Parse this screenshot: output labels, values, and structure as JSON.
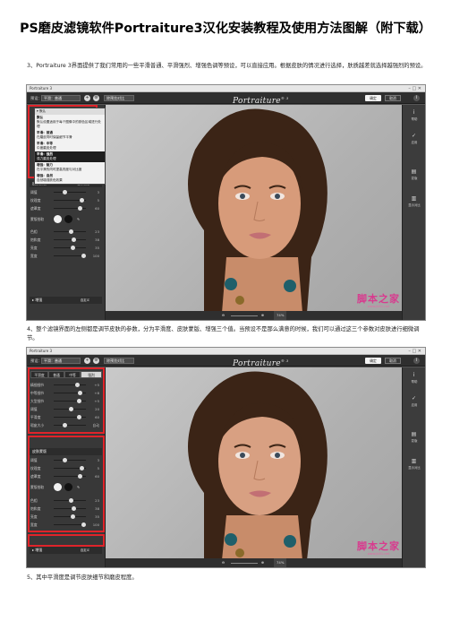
{
  "doc": {
    "title": "PS磨皮滤镜软件Portraiture3汉化安装教程及使用方法图解（附下载）",
    "para3": "3、Portraiture 3界面提供了我们常用的一些平滑普通、平滑强烈、增强色调等预设，可以直接应用。根据皮肤的情况进行选择，肤质越差就选择越强烈的预设。",
    "para4": "4、整个滤镜界面的左侧都是调节皮肤的参数，分为平滑度、皮肤蒙版、增强三个值。当预设不是那么满意的时候，我们可以通过这三个参数对皮肤进行细微调节。",
    "para5": "5、其中平滑度是调节皮肤细节和磨皮程度。"
  },
  "shot1": {
    "window_title": "Portraiture 3",
    "window_controls": "–  □  ✕",
    "toolbar": {
      "preset_label": "预设：",
      "preset_value": "平滑：普通",
      "compare": "除预览对比",
      "logo": "Portraiture",
      "logo_ver": "® 3",
      "ok": "确定",
      "cancel": "取消"
    },
    "dropdown": {
      "header": "▾ 默认",
      "items": [
        {
          "title": "默认",
          "desc": "默认设置适用于每个图像中的肤色区域进行处理"
        },
        {
          "title": "平滑：普通",
          "desc": "在磨皮同时保留细节平滑"
        },
        {
          "title": "平滑：中等",
          "desc": "中度磨皮处理"
        },
        {
          "title": "平滑：强烈",
          "desc": "强力磨皮处理"
        },
        {
          "title": "增强：魅力",
          "desc": "在平滑的同时提高亮度与对比度"
        },
        {
          "title": "增强：自然",
          "desc": "自然增强肤色效果"
        }
      ]
    },
    "mask": {
      "header": "皮肤蒙版",
      "show": "显示蒙版",
      "rows": [
        {
          "label": "色相",
          "value": "23",
          "pos": 0.5
        },
        {
          "label": "饱和度",
          "value": "38",
          "pos": 0.6
        },
        {
          "label": "亮度",
          "value": "35",
          "pos": 0.55
        },
        {
          "label": "宽度",
          "value": "100",
          "pos": 0.9
        }
      ],
      "smoothing_rows": [
        {
          "label": "阈值",
          "value": "3",
          "pos": 0.3
        },
        {
          "label": "纹理度",
          "value": "5",
          "pos": 0.85
        },
        {
          "label": "遮罩度",
          "value": "60",
          "pos": 0.8
        }
      ],
      "picker": "蒙版拾取"
    },
    "enhance": {
      "header": "▸ 增强",
      "mode": "自定义"
    },
    "zoom": "74%",
    "rightbar": [
      {
        "icon": "i",
        "label": "帮助"
      },
      {
        "icon": "✓",
        "label": "应用"
      },
      {
        "icon": "▤",
        "label": "蒙版"
      },
      {
        "icon": "▥",
        "label": "显示对比"
      }
    ]
  },
  "shot2": {
    "window_title": "Portraiture 3",
    "window_controls": "–  □  ✕",
    "tabs": {
      "t1": "平滑度",
      "t2": "普通",
      "t3": "中等",
      "t4": "强烈"
    },
    "smoothing": [
      {
        "label": "精细细节",
        "value": "+5",
        "pos": 0.7
      },
      {
        "label": "中等细节",
        "value": "+8",
        "pos": 0.8
      },
      {
        "label": "大型细节",
        "value": "+5",
        "pos": 0.75
      },
      {
        "label": "阈值",
        "value": "20",
        "pos": 0.5
      },
      {
        "label": "平滑度",
        "value": "60",
        "pos": 0.75
      },
      {
        "label": "瑕疵大小",
        "value": "自动",
        "pos": 0.3
      }
    ],
    "mask_header": "皮肤蒙版",
    "mask_rows": [
      {
        "label": "阈值",
        "value": "3",
        "pos": 0.3
      },
      {
        "label": "纹理度",
        "value": "5",
        "pos": 0.85
      },
      {
        "label": "遮罩度",
        "value": "60",
        "pos": 0.8
      }
    ],
    "color_rows": [
      {
        "label": "色相",
        "value": "23",
        "pos": 0.5
      },
      {
        "label": "饱和度",
        "value": "38",
        "pos": 0.6
      },
      {
        "label": "亮度",
        "value": "35",
        "pos": 0.55
      },
      {
        "label": "宽度",
        "value": "100",
        "pos": 0.9
      }
    ],
    "enhance": {
      "header": "▸ 增强",
      "mode": "自定义"
    },
    "zoom": "74%"
  },
  "watermark": {
    "main": "脚本之家",
    "sub": "www.jb51.net"
  },
  "colors": {
    "red": "#e0242a",
    "accent_pink": "#d83a8e"
  }
}
